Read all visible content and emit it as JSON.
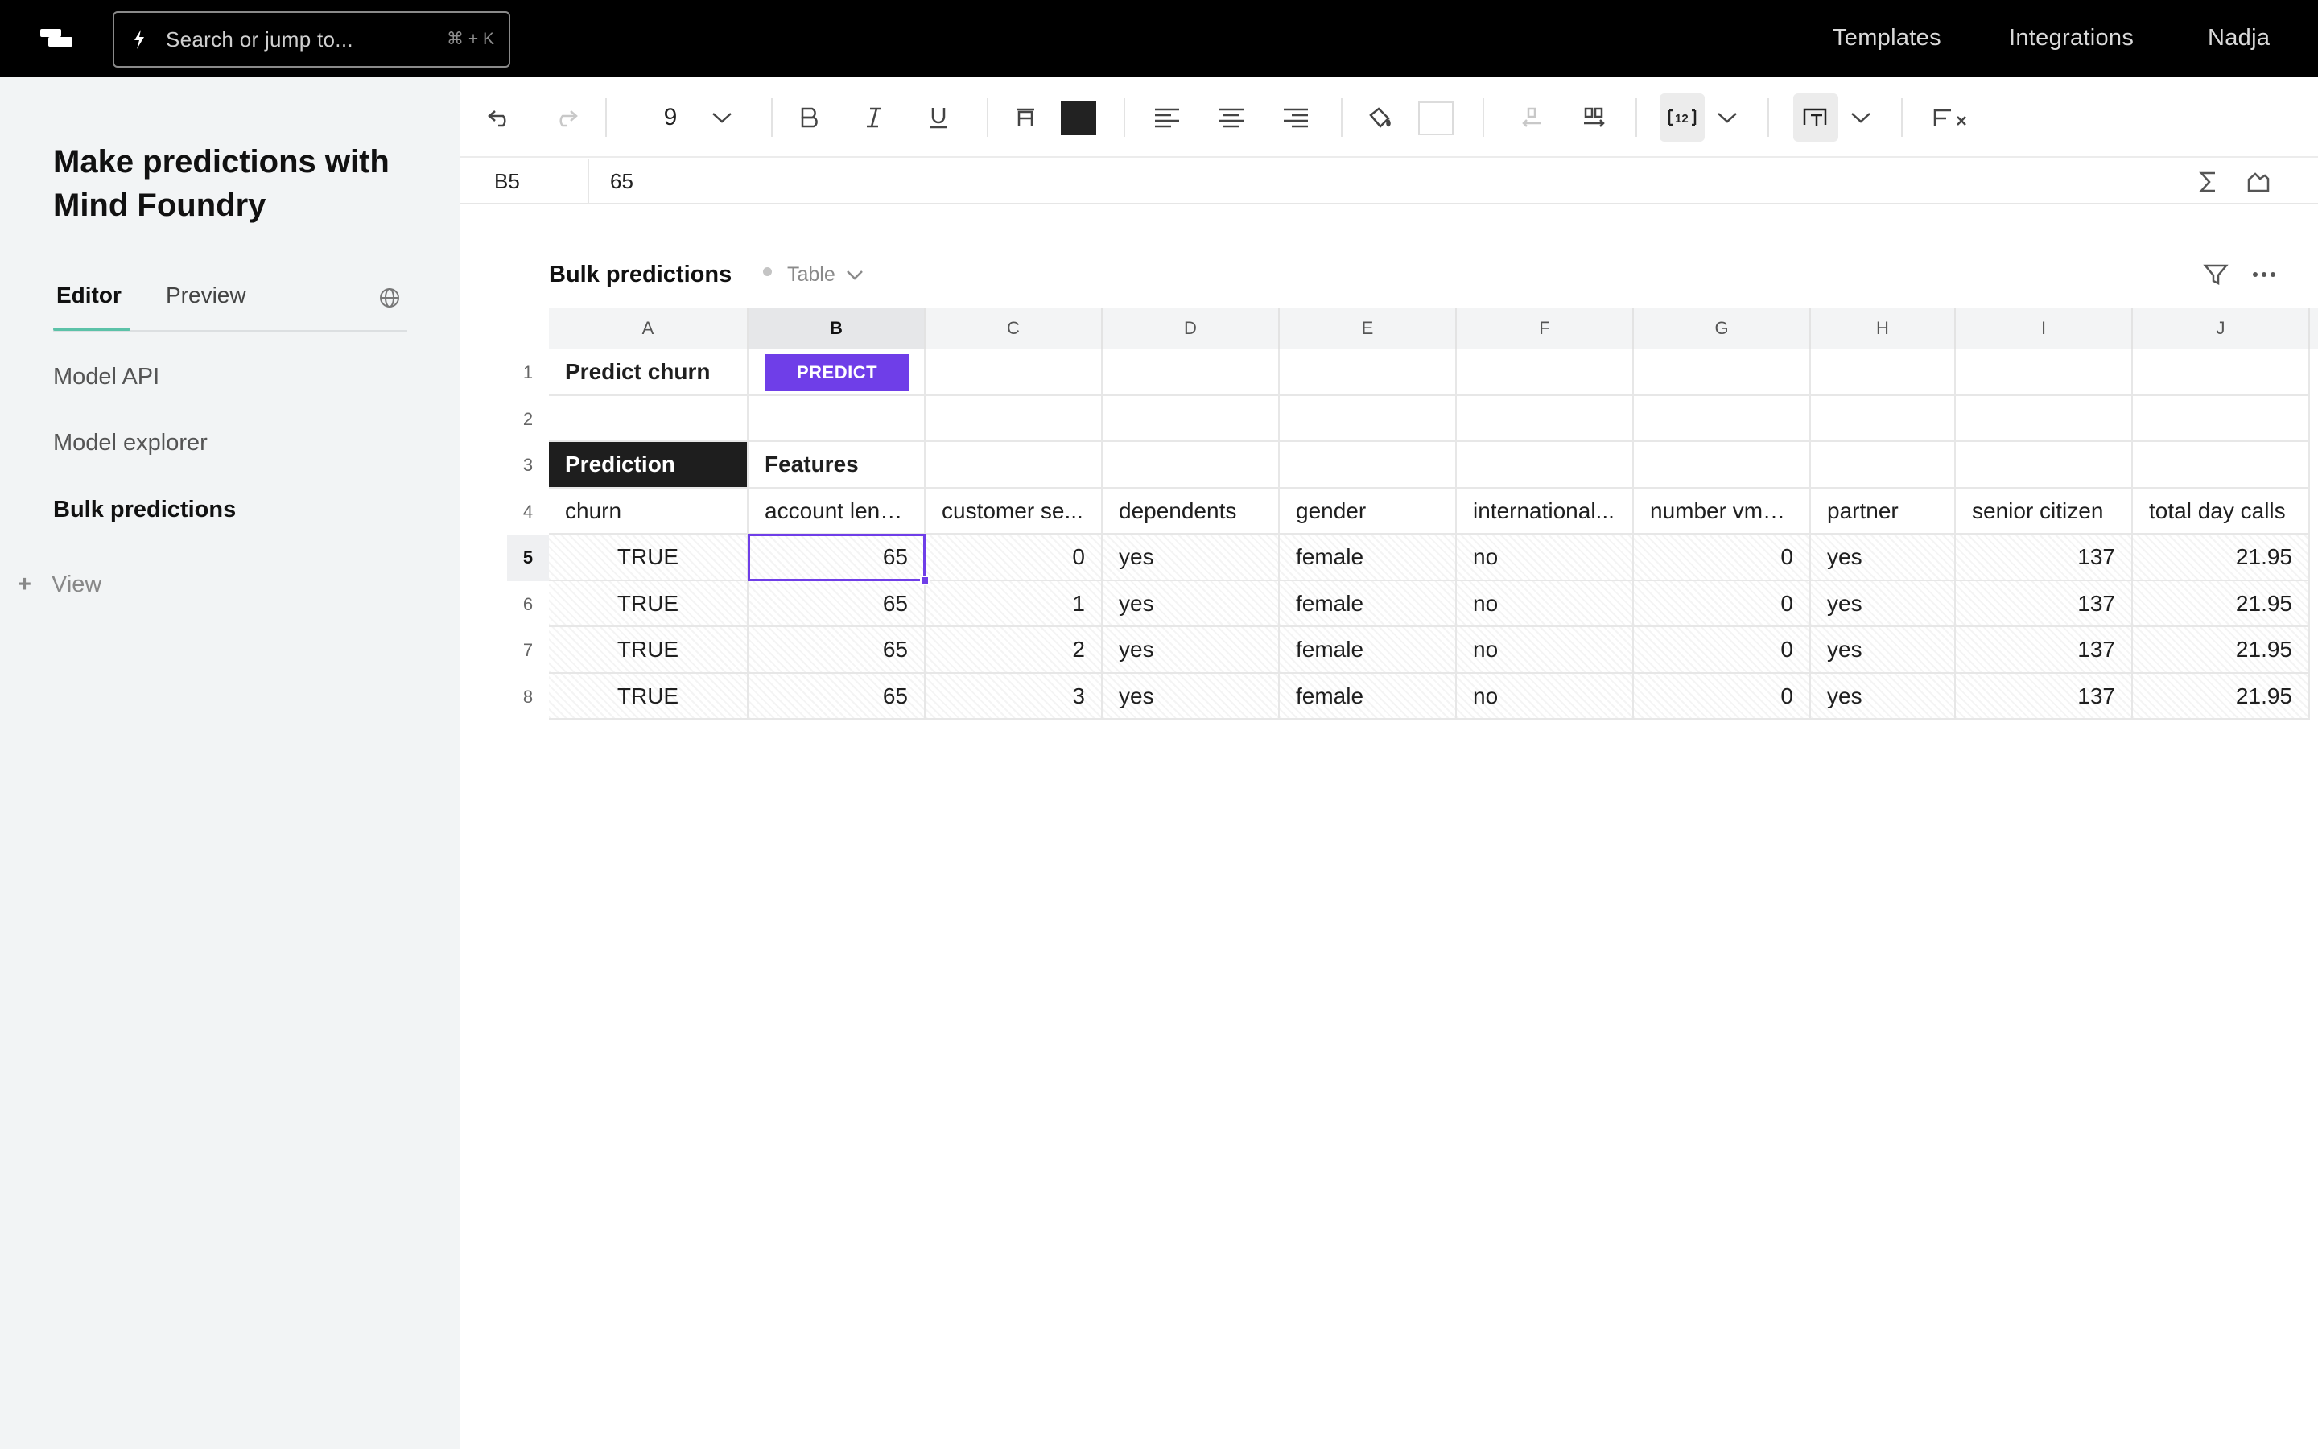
{
  "topbar": {
    "search_placeholder": "Search or jump to...",
    "search_shortcut": "⌘ + K",
    "nav": [
      "Templates",
      "Integrations",
      "Nadja"
    ]
  },
  "sidebar": {
    "doc_title": "Make predictions with Mind Foundry",
    "tabs": [
      "Editor",
      "Preview"
    ],
    "active_tab": "Editor",
    "pages": [
      "Model API",
      "Model explorer",
      "Bulk predictions"
    ],
    "active_page": "Bulk predictions",
    "add_view_label": "View"
  },
  "toolbar": {
    "font_size": "9",
    "text_color": "#222222",
    "fill_color": "#ffffff"
  },
  "formula_bar": {
    "cell_ref": "B5",
    "value": "65"
  },
  "table": {
    "title": "Bulk predictions",
    "type_label": "Table",
    "columns": [
      "A",
      "B",
      "C",
      "D",
      "E",
      "F",
      "G",
      "H",
      "I",
      "J"
    ],
    "selected_column": "B",
    "selected_row": "5",
    "row_numbers": [
      "1",
      "2",
      "3",
      "4",
      "5",
      "6",
      "7",
      "8"
    ],
    "predict_label": "Predict churn",
    "predict_button": "PREDICT",
    "section_prediction": "Prediction",
    "section_features": "Features",
    "headers": [
      "churn",
      "account leng...",
      "customer se...",
      "dependents",
      "gender",
      "international...",
      "number vma...",
      "partner",
      "senior citizen",
      "total day calls"
    ],
    "rows": [
      [
        "TRUE",
        "65",
        "0",
        "yes",
        "female",
        "no",
        "0",
        "yes",
        "137",
        "21.95"
      ],
      [
        "TRUE",
        "65",
        "1",
        "yes",
        "female",
        "no",
        "0",
        "yes",
        "137",
        "21.95"
      ],
      [
        "TRUE",
        "65",
        "2",
        "yes",
        "female",
        "no",
        "0",
        "yes",
        "137",
        "21.95"
      ],
      [
        "TRUE",
        "65",
        "3",
        "yes",
        "female",
        "no",
        "0",
        "yes",
        "137",
        "21.95"
      ]
    ]
  },
  "colors": {
    "accent": "#6f3ee8",
    "tab_underline": "#5cc2a8",
    "topbar": "#000000",
    "sidebar": "#f2f4f5"
  }
}
